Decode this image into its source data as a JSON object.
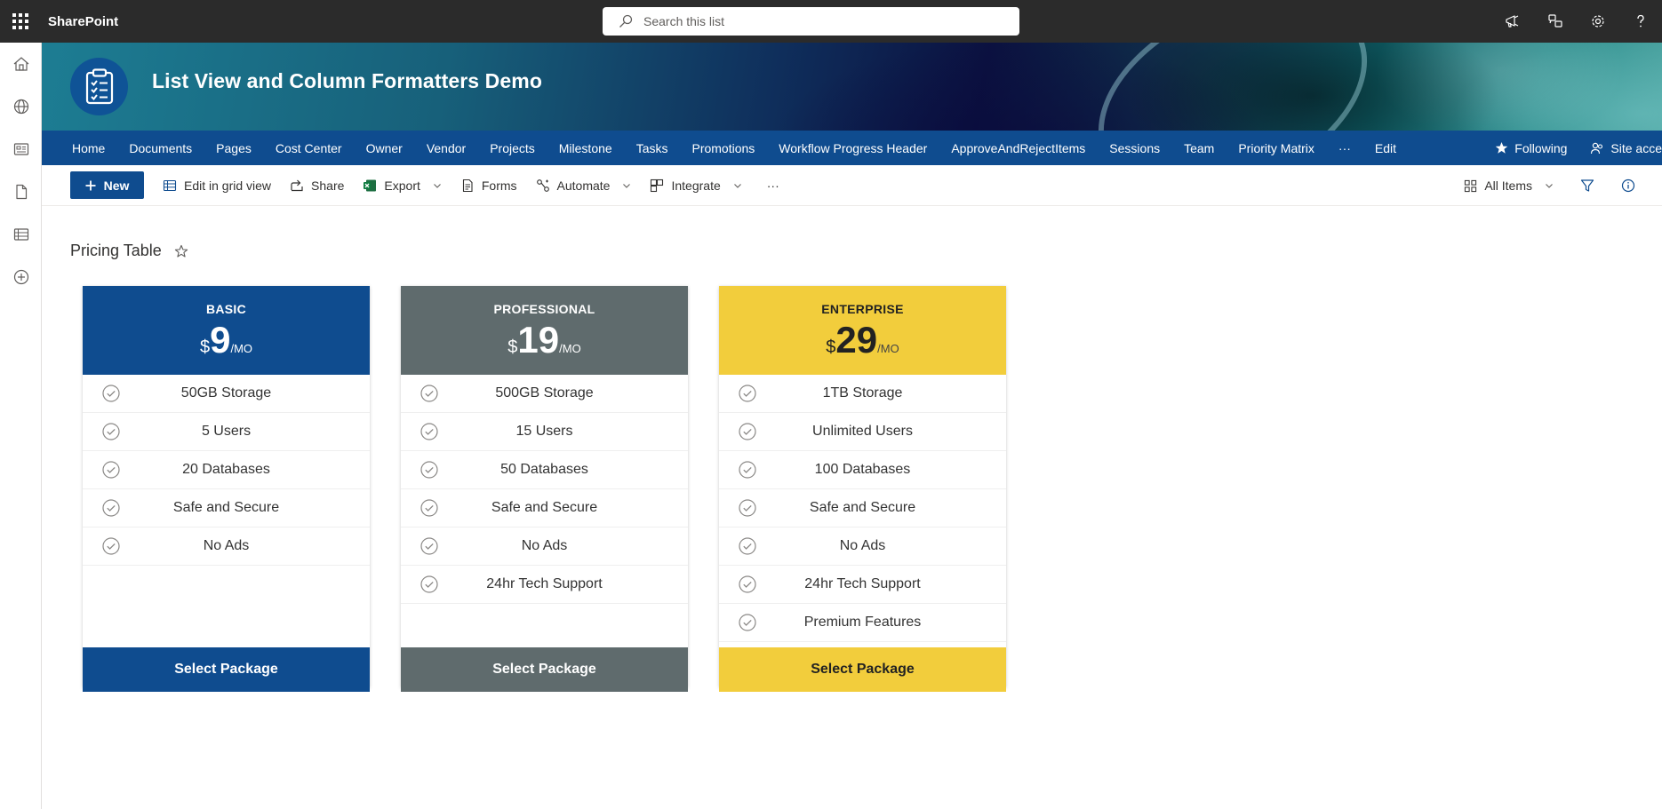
{
  "suitebar": {
    "brand": "SharePoint",
    "search_placeholder": "Search this list",
    "icons": [
      "announcement-icon",
      "feedback-icon",
      "gear-icon",
      "help-icon"
    ]
  },
  "leftrail": {
    "icons": [
      "home-icon",
      "globe-icon",
      "news-icon",
      "files-icon",
      "lists-icon",
      "create-icon"
    ]
  },
  "site": {
    "title": "List View and Column Formatters Demo",
    "logo_icon": "clipboard-checklist-icon"
  },
  "hubnav": {
    "items": [
      "Home",
      "Documents",
      "Pages",
      "Cost Center",
      "Owner",
      "Vendor",
      "Projects",
      "Milestone",
      "Tasks",
      "Promotions",
      "Workflow Progress Header",
      "ApproveAndRejectItems",
      "Sessions",
      "Team",
      "Priority Matrix",
      "···",
      "Edit"
    ],
    "following": "Following",
    "site_access": "Site access"
  },
  "commandbar": {
    "new": "New",
    "edit_grid": "Edit in grid view",
    "share": "Share",
    "export": "Export",
    "forms": "Forms",
    "automate": "Automate",
    "integrate": "Integrate",
    "more": "···",
    "view": "All Items"
  },
  "list": {
    "title": "Pricing Table"
  },
  "plans": [
    {
      "name": "BASIC",
      "currency": "$",
      "price": "9",
      "per": "/MO",
      "color": "#0f4c8f",
      "features": [
        "50GB Storage",
        "5 Users",
        "20 Databases",
        "Safe and Secure",
        "No Ads"
      ],
      "cta": "Select Package"
    },
    {
      "name": "PROFESSIONAL",
      "currency": "$",
      "price": "19",
      "per": "/MO",
      "color": "#5f6b6d",
      "features": [
        "500GB Storage",
        "15 Users",
        "50 Databases",
        "Safe and Secure",
        "No Ads",
        "24hr Tech Support"
      ],
      "cta": "Select Package"
    },
    {
      "name": "ENTERPRISE",
      "currency": "$",
      "price": "29",
      "per": "/MO",
      "color": "#f2cd3c",
      "features": [
        "1TB Storage",
        "Unlimited Users",
        "100 Databases",
        "Safe and Secure",
        "No Ads",
        "24hr Tech Support",
        "Premium Features"
      ],
      "cta": "Select Package"
    }
  ]
}
